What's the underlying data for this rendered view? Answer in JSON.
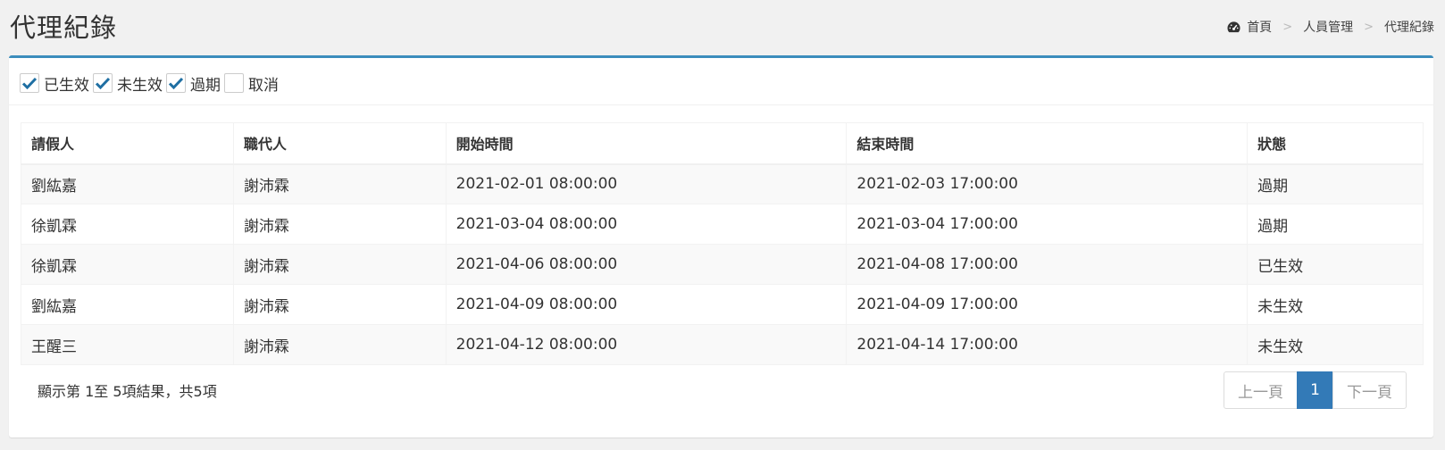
{
  "header": {
    "title": "代理紀錄",
    "breadcrumb": {
      "home": "首頁",
      "separator": ">",
      "section": "人員管理",
      "current": "代理紀錄"
    }
  },
  "filters": [
    {
      "label": "已生效",
      "checked": true
    },
    {
      "label": "未生效",
      "checked": true
    },
    {
      "label": "過期",
      "checked": true
    },
    {
      "label": "取消",
      "checked": false
    }
  ],
  "table": {
    "columns": [
      "請假人",
      "職代人",
      "開始時間",
      "結束時間",
      "狀態"
    ],
    "rows": [
      [
        "劉紘嘉",
        "謝沛霖",
        "2021-02-01 08:00:00",
        "2021-02-03 17:00:00",
        "過期"
      ],
      [
        "徐凱霖",
        "謝沛霖",
        "2021-03-04 08:00:00",
        "2021-03-04 17:00:00",
        "過期"
      ],
      [
        "徐凱霖",
        "謝沛霖",
        "2021-04-06 08:00:00",
        "2021-04-08 17:00:00",
        "已生效"
      ],
      [
        "劉紘嘉",
        "謝沛霖",
        "2021-04-09 08:00:00",
        "2021-04-09 17:00:00",
        "未生效"
      ],
      [
        "王醒三",
        "謝沛霖",
        "2021-04-12 08:00:00",
        "2021-04-14 17:00:00",
        "未生效"
      ]
    ]
  },
  "footer": {
    "info": "顯示第 1至 5項結果，共5項",
    "pagination": {
      "prev": "上一頁",
      "current": "1",
      "next": "下一頁"
    }
  },
  "colors": {
    "accent": "#3c8dbc",
    "active_page": "#337ab7",
    "check": "#1f6fa3"
  },
  "icons": {
    "breadcrumb_home": "dashboard-icon",
    "checkbox": "checkmark-icon"
  }
}
